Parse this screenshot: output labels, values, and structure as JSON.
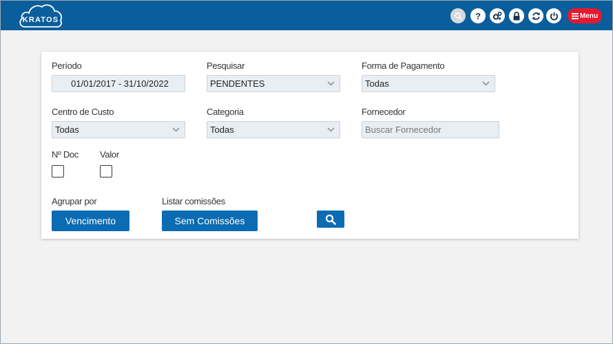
{
  "app": {
    "logo_text": "KRATOS",
    "menu_label": "Menu",
    "help_label": "?",
    "icons": [
      "search-icon",
      "help-icon",
      "cogs-icon",
      "lock-icon",
      "refresh-icon",
      "power-icon",
      "hamburger-icon"
    ],
    "colors": {
      "topbar": "#0b5e9c",
      "menu": "#e8182f",
      "button": "#0b6bb3"
    }
  },
  "filters": {
    "periodo": {
      "label": "Período",
      "value": "01/01/2017 - 31/10/2022"
    },
    "pesquisar": {
      "label": "Pesquisar",
      "value": "PENDENTES"
    },
    "forma_pagamento": {
      "label": "Forma de Pagamento",
      "value": "Todas"
    },
    "centro_custo": {
      "label": "Centro de Custo",
      "value": "Todas"
    },
    "categoria": {
      "label": "Categoria",
      "value": "Todas"
    },
    "fornecedor": {
      "label": "Fornecedor",
      "placeholder": "Buscar Fornecedor"
    },
    "n_doc": {
      "label": "Nº Doc",
      "checked": false
    },
    "valor": {
      "label": "Valor",
      "checked": false
    },
    "agrupar": {
      "label": "Agrupar por",
      "button": "Vencimento"
    },
    "comissoes": {
      "label": "Listar comissões",
      "button": "Sem Comissões"
    }
  }
}
